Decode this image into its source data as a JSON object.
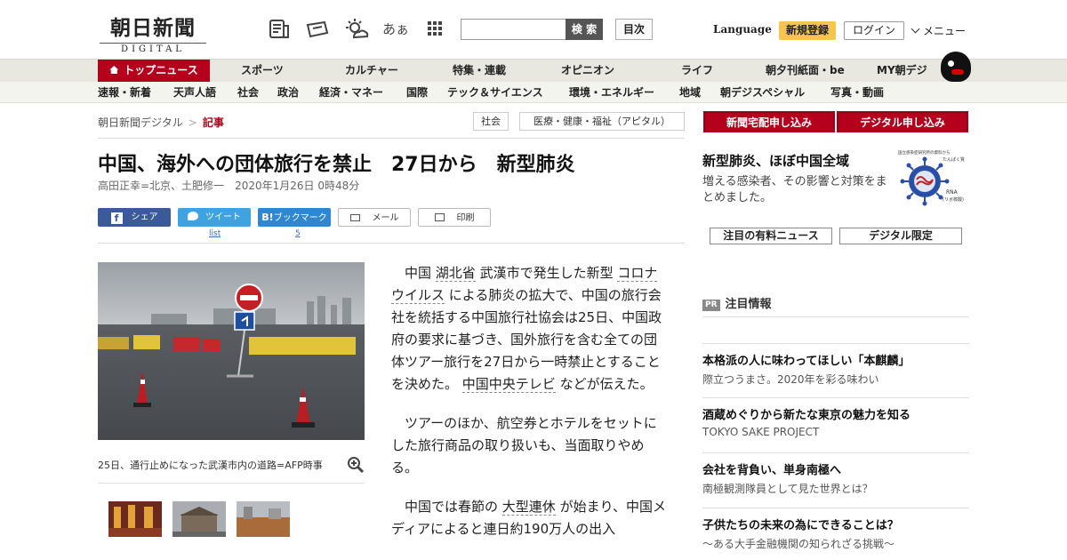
{
  "header": {
    "logo_main": "朝日新聞",
    "logo_sub": "DIGITAL",
    "icons": [
      "newspaper-icon",
      "ticket-icon",
      "weather-icon",
      "font-size-icon",
      "grid-menu-icon"
    ],
    "font_icon_text": "あぁ",
    "search_placeholder": "",
    "search_button": "検 索",
    "index_button": "目次",
    "language": "Language",
    "signup": "新規登録",
    "login": "ログイン",
    "menu": "メニュー"
  },
  "nav_primary": [
    "トップニュース",
    "スポーツ",
    "カルチャー",
    "特集・連載",
    "オピニオン",
    "ライフ",
    "朝夕刊紙面・be",
    "MY朝デジ"
  ],
  "nav_secondary": [
    "速報・新着",
    "天声人語",
    "社会",
    "政治",
    "経済・マネー",
    "国際",
    "テック＆サイエンス",
    "環境・エネルギー",
    "地域",
    "朝デジスペシャル",
    "写真・動画"
  ],
  "breadcrumb": {
    "home": "朝日新聞デジタル",
    "current": "記事"
  },
  "tags": [
    "社会",
    "医療・健康・福祉（アピタル）"
  ],
  "article": {
    "headline": "中国、海外への団体旅行を禁止　27日から　新型肺炎",
    "byline": "高田正幸=北京、土肥修一",
    "date": "2020年1月26日 0時48分",
    "share": {
      "facebook": "シェア",
      "twitter": "ツイート",
      "hatena": "ブックマーク",
      "hatena_mark": "B!",
      "mail": "メール",
      "print": "印刷",
      "twitter_count": "list",
      "hatena_count": "5"
    },
    "caption": "25日、通行止めになった武漢市内の道路=AFP時事",
    "paragraphs": [
      {
        "t1": "中国 ",
        "l1": "湖北省",
        "t2": " 武漢市で発生した新型 ",
        "l2": "コロナウイルス",
        "t3": " による肺炎の拡大で、中国の旅行会社を統括する中国旅行社協会は25日、中国政府の要求に基づき、国外旅行を含む全ての団体ツアー旅行を27日から一時禁止とすることを決めた。 ",
        "l3": "中国中央テレビ",
        "t4": " などが伝えた。"
      },
      {
        "t1": "ツアーのほか、航空券とホテルをセットにした旅行商品の取り扱いも、当面取りやめる。"
      },
      {
        "t1": "中国では春節の ",
        "l1": "大型連休",
        "t2": " が始まり、中国メディアによると連日約190万人の出入"
      }
    ]
  },
  "sidebar": {
    "buttons": [
      "新聞宅配申し込み",
      "デジタル申し込み"
    ],
    "feature_title": "新型肺炎、ほぼ中国全域",
    "feature_desc": "増える感染者、その影響と対策をまとめました。",
    "virus_labels": [
      "国立感染症研究所の資料から",
      "たんぱく質",
      "RNA",
      "(リボ核酸)"
    ],
    "box_buttons": [
      "注目の有料ニュース",
      "デジタル限定"
    ],
    "pr_badge": "PR",
    "pr_heading": "注目情報",
    "pr_items": [
      {
        "title": "本格派の人に味わってほしい「本麒麟」",
        "sub": "際立つうまさ。2020年を彩る味わい"
      },
      {
        "title": "酒蔵めぐりから新たな東京の魅力を知る",
        "sub": "TOKYO SAKE PROJECT"
      },
      {
        "title": "会社を背負い、単身南極へ",
        "sub": "南極観測隊員として見た世界とは？"
      },
      {
        "title": "子供たちの未来の為にできることは？",
        "sub": "～ある大手金融機関の知られざる挑戦～"
      }
    ]
  },
  "colors": {
    "brand_red": "#b4001c",
    "signup_yellow": "#f5c64f",
    "facebook": "#3b5a9a",
    "twitter": "#3ea3e0",
    "hatena": "#2f87d1"
  }
}
